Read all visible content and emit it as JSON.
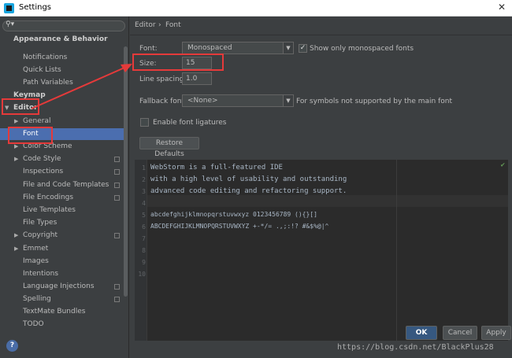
{
  "window": {
    "title": "Settings",
    "close_glyph": "✕"
  },
  "search": {
    "placeholder": "",
    "icon": "search-icon"
  },
  "sidebar": {
    "items": [
      {
        "label": "Appearance & Behavior",
        "bold": true
      },
      {
        "label": "Notifications"
      },
      {
        "label": "Quick Lists"
      },
      {
        "label": "Path Variables"
      },
      {
        "label": "Keymap",
        "bold": true
      },
      {
        "label": "Editor",
        "bold": true,
        "expanded": true
      },
      {
        "label": "General"
      },
      {
        "label": "Font",
        "selected": true
      },
      {
        "label": "Color Scheme"
      },
      {
        "label": "Code Style"
      },
      {
        "label": "Inspections"
      },
      {
        "label": "File and Code Templates"
      },
      {
        "label": "File Encodings"
      },
      {
        "label": "Live Templates"
      },
      {
        "label": "File Types"
      },
      {
        "label": "Copyright"
      },
      {
        "label": "Emmet"
      },
      {
        "label": "Images"
      },
      {
        "label": "Intentions"
      },
      {
        "label": "Language Injections"
      },
      {
        "label": "Spelling"
      },
      {
        "label": "TextMate Bundles"
      },
      {
        "label": "TODO"
      }
    ],
    "help_label": "?"
  },
  "breadcrumb": {
    "section": "Editor",
    "separator": "›",
    "page": "Font"
  },
  "settings": {
    "font_label": "Font:",
    "font_value": "Monospaced",
    "mono_only_label": "Show only monospaced fonts",
    "mono_only_checked": true,
    "size_label": "Size:",
    "size_value": "15",
    "line_spacing_label": "Line spacing:",
    "line_spacing_value": "1.0",
    "fallback_label": "Fallback font:",
    "fallback_value": "<None>",
    "fallback_hint": "For symbols not supported by the main font",
    "ligatures_label": "Enable font ligatures",
    "ligatures_checked": false,
    "restore_label": "Restore Defaults"
  },
  "preview": {
    "line_numbers": [
      "1",
      "2",
      "3",
      "4",
      "5",
      "6",
      "7",
      "8",
      "9",
      "10"
    ],
    "lines": [
      "WebStorm is a full-featured IDE",
      "with a high level of usability and outstanding",
      "advanced code editing and refactoring support.",
      "",
      "abcdefghijklmnopqrstuvwxyz 0123456789 (){}[]",
      "ABCDEFGHIJKLMNOPQRSTUVWXYZ +-*/= .,;:!? #&$%@|^",
      "",
      "",
      "",
      ""
    ]
  },
  "buttons": {
    "ok": "OK",
    "cancel": "Cancel",
    "apply": "Apply"
  },
  "watermark": "https://blog.csdn.net/BlackPlus28",
  "colors": {
    "accent": "#4b6eaf",
    "annotation": "#e53a3a",
    "background": "#3c3f41",
    "editor_bg": "#2b2b2b"
  }
}
